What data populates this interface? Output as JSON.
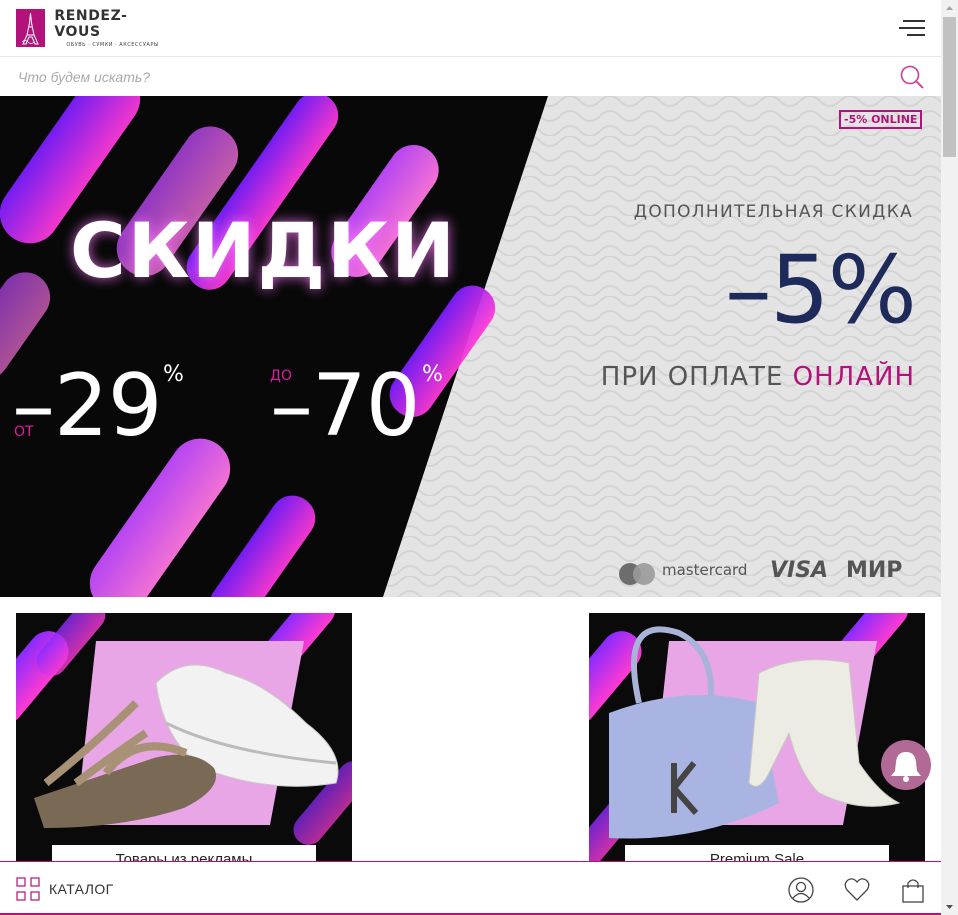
{
  "header": {
    "logo_name": "RENDEZ-VOUS",
    "logo_tagline": "ОБУВЬ · СУМКИ · АКСЕССУАРЫ",
    "menu_icon": "hamburger-menu-icon"
  },
  "search": {
    "placeholder": "Что будем искать?",
    "icon": "search-icon"
  },
  "banner": {
    "title": "СКИДКИ",
    "from_prefix": "ОТ",
    "from_value": "–29",
    "to_prefix": "ДО",
    "to_value": "–70",
    "percent_sign": "%",
    "online_badge": "-5% ONLINE",
    "extra_label": "ДОПОЛНИТЕЛЬНАЯ СКИДКА",
    "extra_value": "–5%",
    "pay_text": "ПРИ ОПЛАТЕ",
    "pay_highlight": "ОНЛАЙН",
    "payment_mastercard": "mastercard",
    "payment_visa": "VISA",
    "payment_mir": "МИР",
    "colors": {
      "accent": "#b3127a",
      "dark_blue": "#1e2a5a",
      "neon": "#e04aff"
    }
  },
  "tiles": [
    {
      "label": "Товары из рекламы"
    },
    {
      "label": "Premium Sale"
    }
  ],
  "bottom_bar": {
    "catalog_label": "КАТАЛОГ",
    "catalog_icon": "grid-icon",
    "profile_icon": "user-icon",
    "wishlist_icon": "heart-icon",
    "cart_icon": "shopping-bag-icon"
  },
  "notification": {
    "icon": "bell-icon"
  }
}
